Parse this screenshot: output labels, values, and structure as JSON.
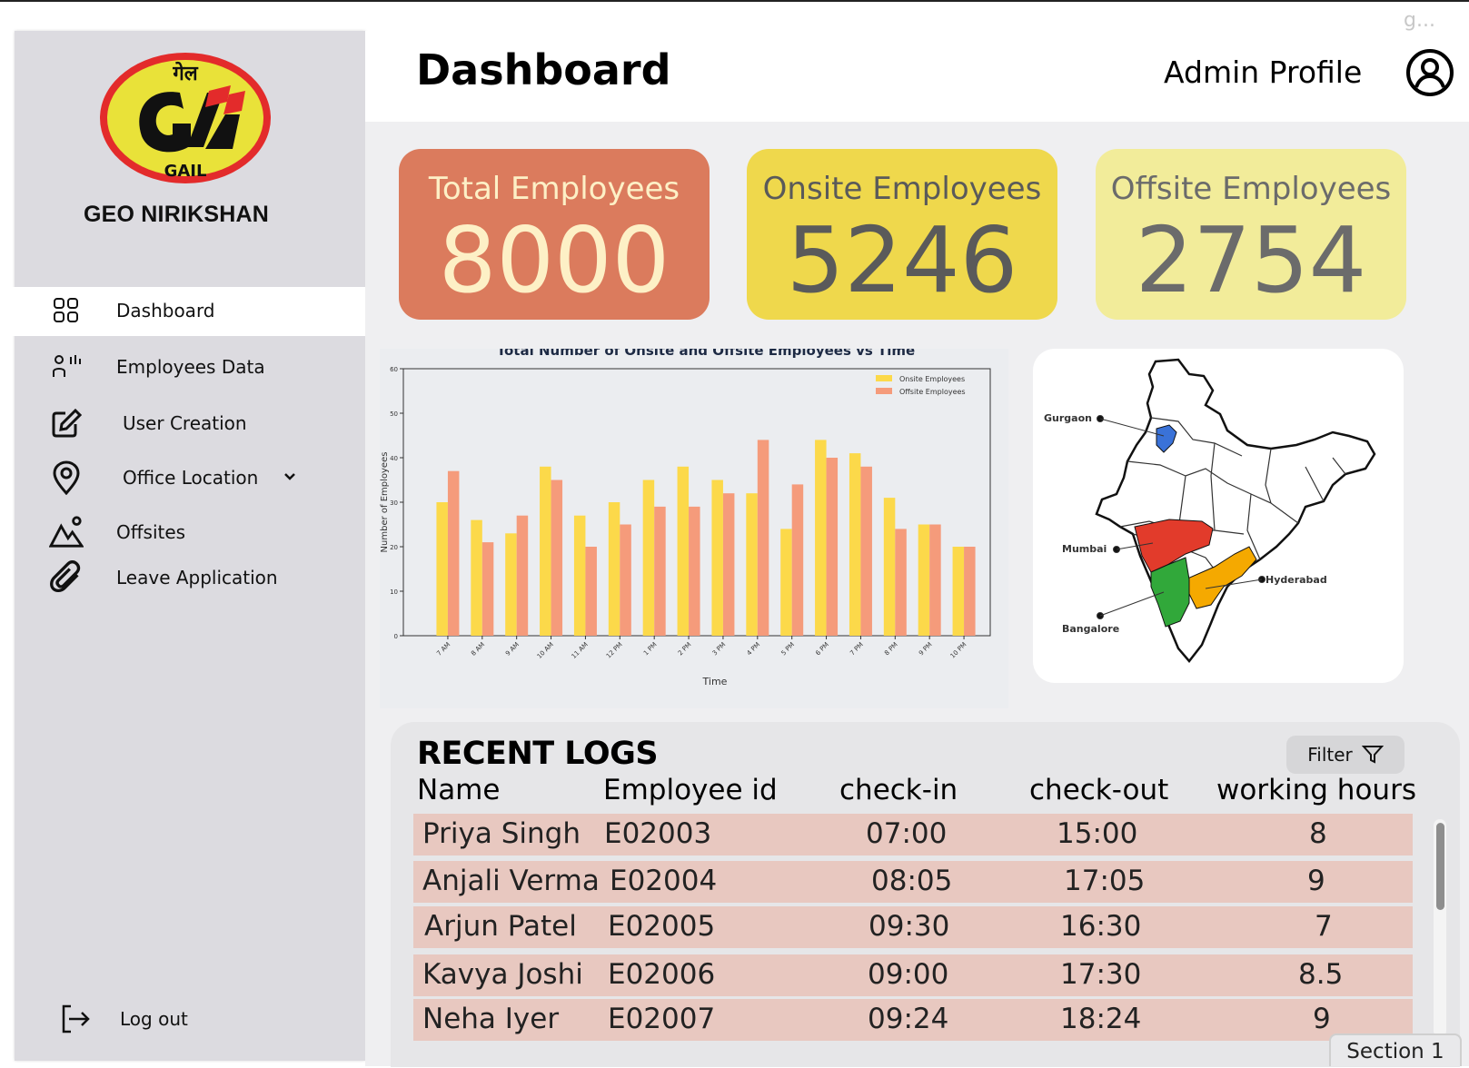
{
  "corner_text": "g...",
  "brand": {
    "logo_top_text": "गेल",
    "logo_bottom_text": "GAIL",
    "app_name": "GEO NIRIKSHAN"
  },
  "sidebar": {
    "items": [
      {
        "label": "Dashboard",
        "icon": "grid-icon",
        "active": true
      },
      {
        "label": "Employees Data",
        "icon": "users-chart-icon"
      },
      {
        "label": "User Creation",
        "icon": "edit-icon"
      },
      {
        "label": "Office Location",
        "icon": "location-pin-icon",
        "has_dropdown": true
      },
      {
        "label": "Offsites",
        "icon": "landscape-icon"
      },
      {
        "label": "Leave Application",
        "icon": "paperclip-icon"
      }
    ],
    "logout_label": "Log out"
  },
  "header": {
    "title": "Dashboard",
    "profile_label": "Admin Profile"
  },
  "stats": {
    "total": {
      "label": "Total Employees",
      "value": "8000"
    },
    "onsite": {
      "label": "Onsite Employees",
      "value": "5246"
    },
    "offsite": {
      "label": "Offsite Employees",
      "value": "2754"
    }
  },
  "chart_data": {
    "type": "bar",
    "title": "Total Number of Onsite and Offsite Employees vs Time",
    "xlabel": "Time",
    "ylabel": "Number of Employees",
    "ylim": [
      0,
      60
    ],
    "yticks": [
      0,
      10,
      20,
      30,
      40,
      50,
      60
    ],
    "legend_position": "top-right",
    "grid": false,
    "categories": [
      "7 AM",
      "8 AM",
      "9 AM",
      "10 AM",
      "11 AM",
      "12 PM",
      "1 PM",
      "2 PM",
      "3 PM",
      "4 PM",
      "5 PM",
      "6 PM",
      "7 PM",
      "8 PM",
      "9 PM",
      "10 PM"
    ],
    "series": [
      {
        "name": "Onsite Employees",
        "color": "#fcd94a",
        "values": [
          30,
          26,
          23,
          38,
          27,
          30,
          35,
          38,
          35,
          32,
          24,
          44,
          41,
          31,
          25,
          20
        ]
      },
      {
        "name": "Offsite Employees",
        "color": "#f59b7b",
        "values": [
          37,
          21,
          27,
          35,
          20,
          25,
          29,
          29,
          32,
          44,
          34,
          40,
          38,
          24,
          25,
          20
        ]
      }
    ]
  },
  "map": {
    "cities": [
      {
        "name": "Gurgaon",
        "color": "#3a72d8"
      },
      {
        "name": "Mumbai",
        "color": "#e23b2b"
      },
      {
        "name": "Hyderabad",
        "color": "#f5a900"
      },
      {
        "name": "Bangalore",
        "color": "#31a83a"
      }
    ]
  },
  "logs": {
    "title": "RECENT LOGS",
    "filter_label": "Filter",
    "columns": [
      "Name",
      "Employee id",
      "check-in",
      "check-out",
      "working hours"
    ],
    "rows": [
      [
        "Priya Singh",
        "E02003",
        "07:00",
        "15:00",
        "8"
      ],
      [
        "Anjali Verma",
        "E02004",
        "08:05",
        "17:05",
        "9"
      ],
      [
        "Arjun Patel",
        "E02005",
        "09:30",
        "16:30",
        "7"
      ],
      [
        "Kavya Joshi",
        "E02006",
        "09:00",
        "17:30",
        "8.5"
      ],
      [
        "Neha Iyer",
        "E02007",
        "09:24",
        "18:24",
        "9"
      ]
    ]
  },
  "section_tab": "Section 1",
  "colors": {
    "total_card": "#db7b5d",
    "onsite_card": "#efd84c",
    "offsite_card": "#f2ec9a",
    "row_bg": "#e8c8c0"
  }
}
